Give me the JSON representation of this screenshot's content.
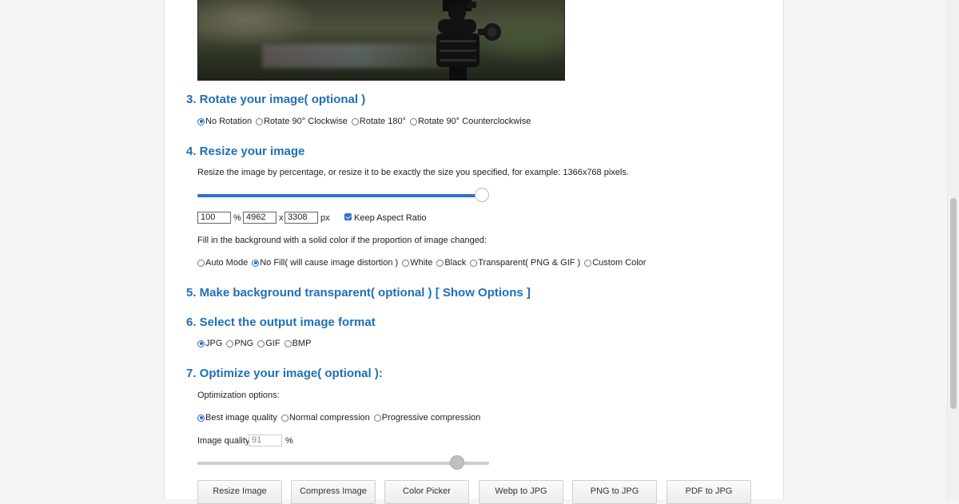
{
  "rotate": {
    "title": "3. Rotate your image( optional )",
    "options": [
      "No Rotation",
      "Rotate 90° Clockwise",
      "Rotate 180°",
      "Rotate 90° Counterclockwise"
    ],
    "selected": "No Rotation"
  },
  "resize": {
    "title": "4. Resize your image",
    "description": "Resize the image by percentage, or resize it to be exactly the size you specified, for example: 1366x768 pixels.",
    "slider_value_percent": 100,
    "percent_value": "100",
    "percent_unit": "%",
    "width_value": "4962",
    "times": "x",
    "height_value": "3308",
    "px_unit": "px",
    "keep_aspect_label": "Keep Aspect Ratio",
    "keep_aspect_checked": true,
    "fill_description": "Fill in the background with a solid color if the proportion of image changed:",
    "fill_options": [
      "Auto Mode",
      "No Fill( will cause image distortion )",
      "White",
      "Black",
      "Transparent( PNG & GIF )",
      "Custom Color"
    ],
    "fill_selected": "No Fill( will cause image distortion )"
  },
  "transparent": {
    "title": "5. Make background transparent( optional )",
    "link": "[ Show Options ]"
  },
  "format": {
    "title": "6. Select the output image format",
    "options": [
      "JPG",
      "PNG",
      "GIF",
      "BMP"
    ],
    "selected": "JPG"
  },
  "optimize": {
    "title": "7. Optimize your image( optional ):",
    "options_label": "Optimization options:",
    "options": [
      "Best image quality",
      "Normal compression",
      "Progressive compression"
    ],
    "selected": "Best image quality",
    "quality_label": "Image quality:",
    "quality_value": "91",
    "quality_unit": "%",
    "quality_slider_percent": 91
  },
  "tools": [
    "Resize Image",
    "Compress Image",
    "Color Picker",
    "Webp to JPG",
    "PNG to JPG",
    "PDF to JPG"
  ],
  "colors": {
    "heading": "#1f6fb8",
    "accent": "#2a6fd0",
    "slider_active": "#2f6fd0",
    "slider_inactive": "#cccccc"
  }
}
